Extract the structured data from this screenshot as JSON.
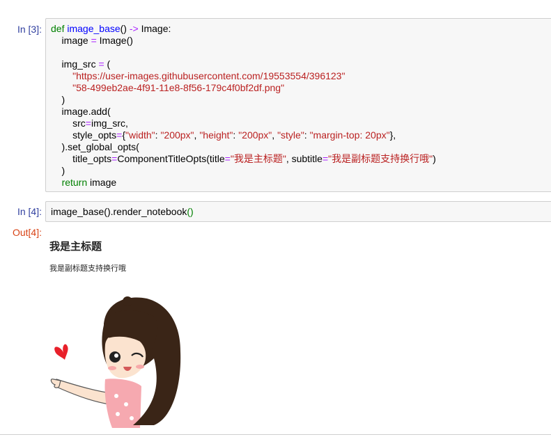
{
  "cells": [
    {
      "prompt": "In [3]:",
      "lines": [
        "def image_base() -> Image:",
        "    image = Image()",
        "",
        "    img_src = (",
        "        \"https://user-images.githubusercontent.com/19553554/396123\"",
        "        \"58-499eb2ae-4f91-11e8-8f56-179c4f0bf2df.png\"",
        "    )",
        "    image.add(",
        "        src=img_src,",
        "        style_opts={\"width\": \"200px\", \"height\": \"200px\", \"style\": \"margin-top: 20px\"},",
        "    ).set_global_opts(",
        "        title_opts=ComponentTitleOpts(title=\"我是主标题\", subtitle=\"我是副标题支持换行哦\")",
        "    )",
        "    return image"
      ]
    },
    {
      "prompt": "In [4]:",
      "lines": [
        "image_base().render_notebook()"
      ]
    }
  ],
  "output": {
    "prompt": "Out[4]:",
    "title": "我是主标题",
    "subtitle": "我是副标题支持换行哦",
    "image": "cartoon-girl-waving-image"
  }
}
